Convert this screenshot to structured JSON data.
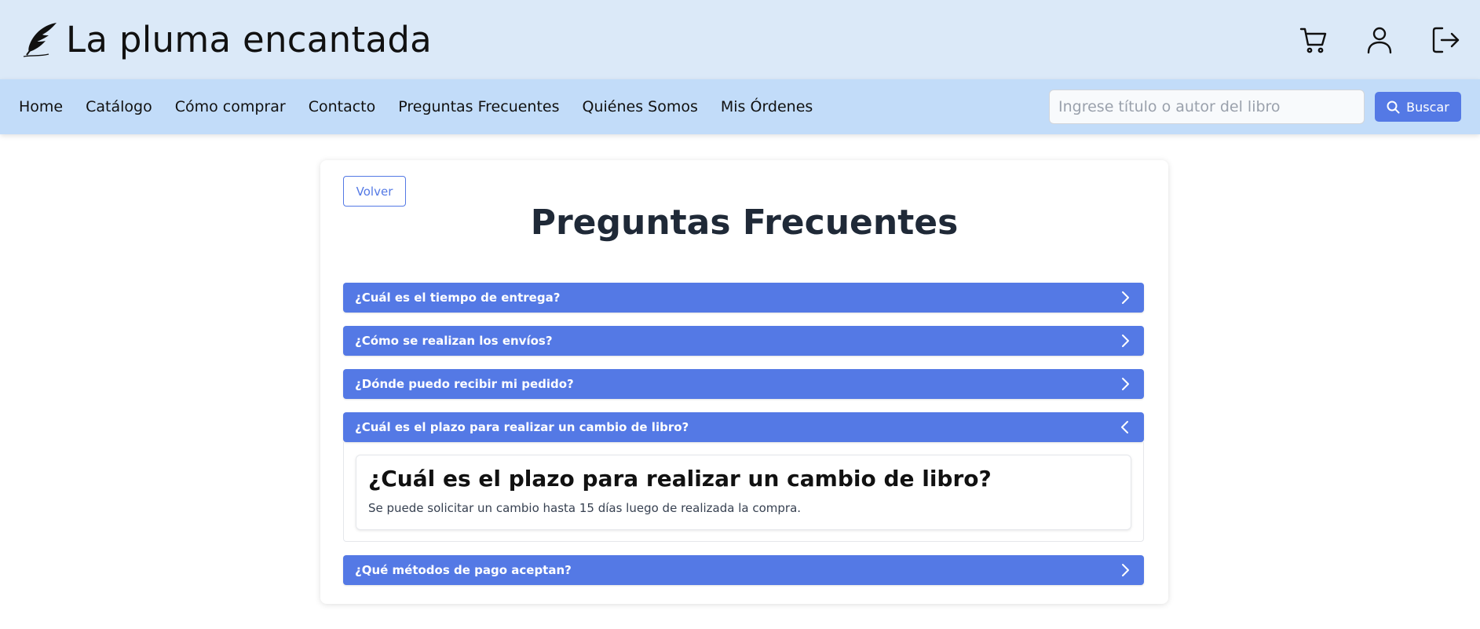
{
  "header": {
    "title": "La pluma encantada",
    "icons": [
      "feather-icon",
      "cart-icon",
      "user-icon",
      "logout-icon"
    ]
  },
  "nav": {
    "links": [
      "Home",
      "Catálogo",
      "Cómo comprar",
      "Contacto",
      "Preguntas Frecuentes",
      "Quiénes Somos",
      "Mis Órdenes"
    ]
  },
  "search": {
    "placeholder": "Ingrese título o autor del libro",
    "value": "",
    "button_label": "Buscar"
  },
  "page": {
    "back_label": "Volver",
    "title": "Preguntas Frecuentes"
  },
  "faq": [
    {
      "question": "¿Cuál es el tiempo de entrega?",
      "open": false
    },
    {
      "question": "¿Cómo se realizan los envíos?",
      "open": false
    },
    {
      "question": "¿Dónde puedo recibir mi pedido?",
      "open": false
    },
    {
      "question": "¿Cuál es el plazo para realizar un cambio de libro?",
      "open": true,
      "answer_title": "¿Cuál es el plazo para realizar un cambio de libro?",
      "answer_text": "Se puede solicitar un cambio hasta 15 días luego de realizada la compra."
    },
    {
      "question": "¿Qué métodos de pago aceptan?",
      "open": false
    }
  ],
  "colors": {
    "header_bg": "#dbe9f8",
    "nav_bg": "#c2dcf9",
    "accent": "#5479e5",
    "title_text": "#1f2937"
  }
}
